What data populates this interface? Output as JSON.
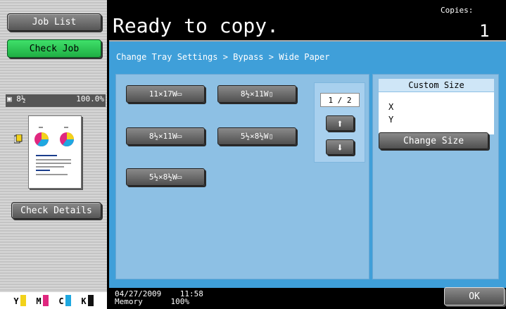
{
  "header": {
    "title": "Ready to copy.",
    "copies_label": "Copies:",
    "copies_value": "1"
  },
  "left": {
    "job_list": "Job List",
    "check_job": "Check Job",
    "check_details": "Check Details",
    "thumb_info_left": "8½",
    "thumb_info_zoom": "100.0%",
    "ink": [
      {
        "label": "Y",
        "color": "#f2d21b"
      },
      {
        "label": "M",
        "color": "#e0277f"
      },
      {
        "label": "C",
        "color": "#1fa8e0"
      },
      {
        "label": "K",
        "color": "#111111"
      }
    ]
  },
  "main": {
    "breadcrumb": "Change Tray Settings > Bypass > Wide Paper",
    "sizes": [
      "11×17W",
      "8½×11W",
      "8½×11W",
      "5½×8½W",
      "5½×8½W"
    ],
    "page_indicator": "1 / 2",
    "custom_size_title": "Custom Size",
    "x_label": "X",
    "y_label": "Y",
    "change_size": "Change Size",
    "ok": "OK"
  },
  "status": {
    "date": "04/27/2009",
    "time": "11:58",
    "memory_label": "Memory",
    "memory_value": "100%"
  },
  "colors": {
    "accent_blue": "#3f9fd9",
    "panel_blue": "#8dc0e4",
    "green_button": "#2fcc58"
  }
}
